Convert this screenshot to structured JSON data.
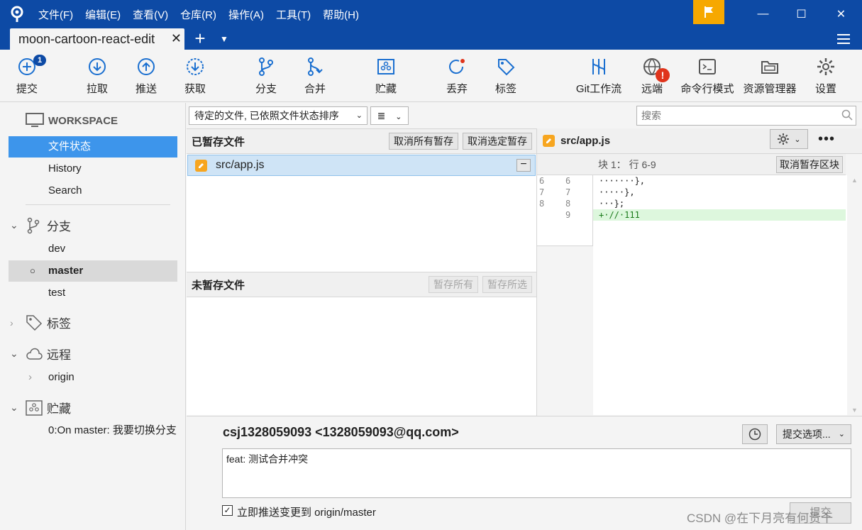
{
  "menu": [
    "文件(F)",
    "编辑(E)",
    "查看(V)",
    "仓库(R)",
    "操作(A)",
    "工具(T)",
    "帮助(H)"
  ],
  "window": {
    "minimize": "—",
    "maximize": "☐",
    "close": "✕"
  },
  "tabs": {
    "active_label": "moon-cartoon-react-edit",
    "close": "✕",
    "add": "+",
    "dropdown": "▼"
  },
  "toolbar": {
    "commit": "提交",
    "commit_badge": "1",
    "pull": "拉取",
    "push": "推送",
    "fetch": "获取",
    "branch": "分支",
    "merge": "合并",
    "stash": "贮藏",
    "discard": "丢弃",
    "tag": "标签",
    "gitflow": "Git工作流",
    "remote": "远端",
    "remote_warning": "!",
    "terminal": "命令行模式",
    "explorer": "资源管理器",
    "settings": "设置"
  },
  "sidebar": {
    "workspace": "WORKSPACE",
    "file_status": "文件状态",
    "history": "History",
    "search": "Search",
    "branches_title": "分支",
    "branches": [
      "dev",
      "master",
      "test"
    ],
    "tags_title": "标签",
    "remotes_title": "远程",
    "remotes": [
      "origin"
    ],
    "stashes_title": "贮藏",
    "stashes": [
      "0:On master: 我要切换分支"
    ]
  },
  "filter": {
    "sort_label": "待定的文件, 已依照文件状态排序",
    "view_label": "≣"
  },
  "search": {
    "placeholder": "搜索"
  },
  "staged": {
    "title": "已暂存文件",
    "unstage_all": "取消所有暂存",
    "unstage_selected": "取消选定暂存",
    "files": [
      "src/app.js"
    ]
  },
  "unstaged": {
    "title": "未暂存文件",
    "stage_all": "暂存所有",
    "stage_selected": "暂存所选"
  },
  "diff": {
    "filename": "src/app.js",
    "hunk_label": "块 1： 行 6-9",
    "hunk_button": "取消暂存区块",
    "more": "•••",
    "lines": [
      {
        "old": "6",
        "new": "6",
        "text": "·······},",
        "type": "context"
      },
      {
        "old": "7",
        "new": "7",
        "text": "·····},",
        "type": "context"
      },
      {
        "old": "8",
        "new": "8",
        "text": "···};",
        "type": "context"
      },
      {
        "old": "",
        "new": "9",
        "text": "+·//·111",
        "type": "added"
      }
    ]
  },
  "commit": {
    "author": "csj1328059093 <1328059093@qq.com>",
    "options": "提交选项...",
    "message": "feat: 测试合并冲突",
    "push_label": "立即推送变更到 origin/master",
    "push_checked": "✓",
    "submit": "提交"
  },
  "watermark": "CSDN @在下月亮有何贵干",
  "colors": {
    "titlebar": "#0d4aa5",
    "accent": "#3d95eb",
    "flag": "#f6a800",
    "added_line": "#ddf7dd"
  }
}
